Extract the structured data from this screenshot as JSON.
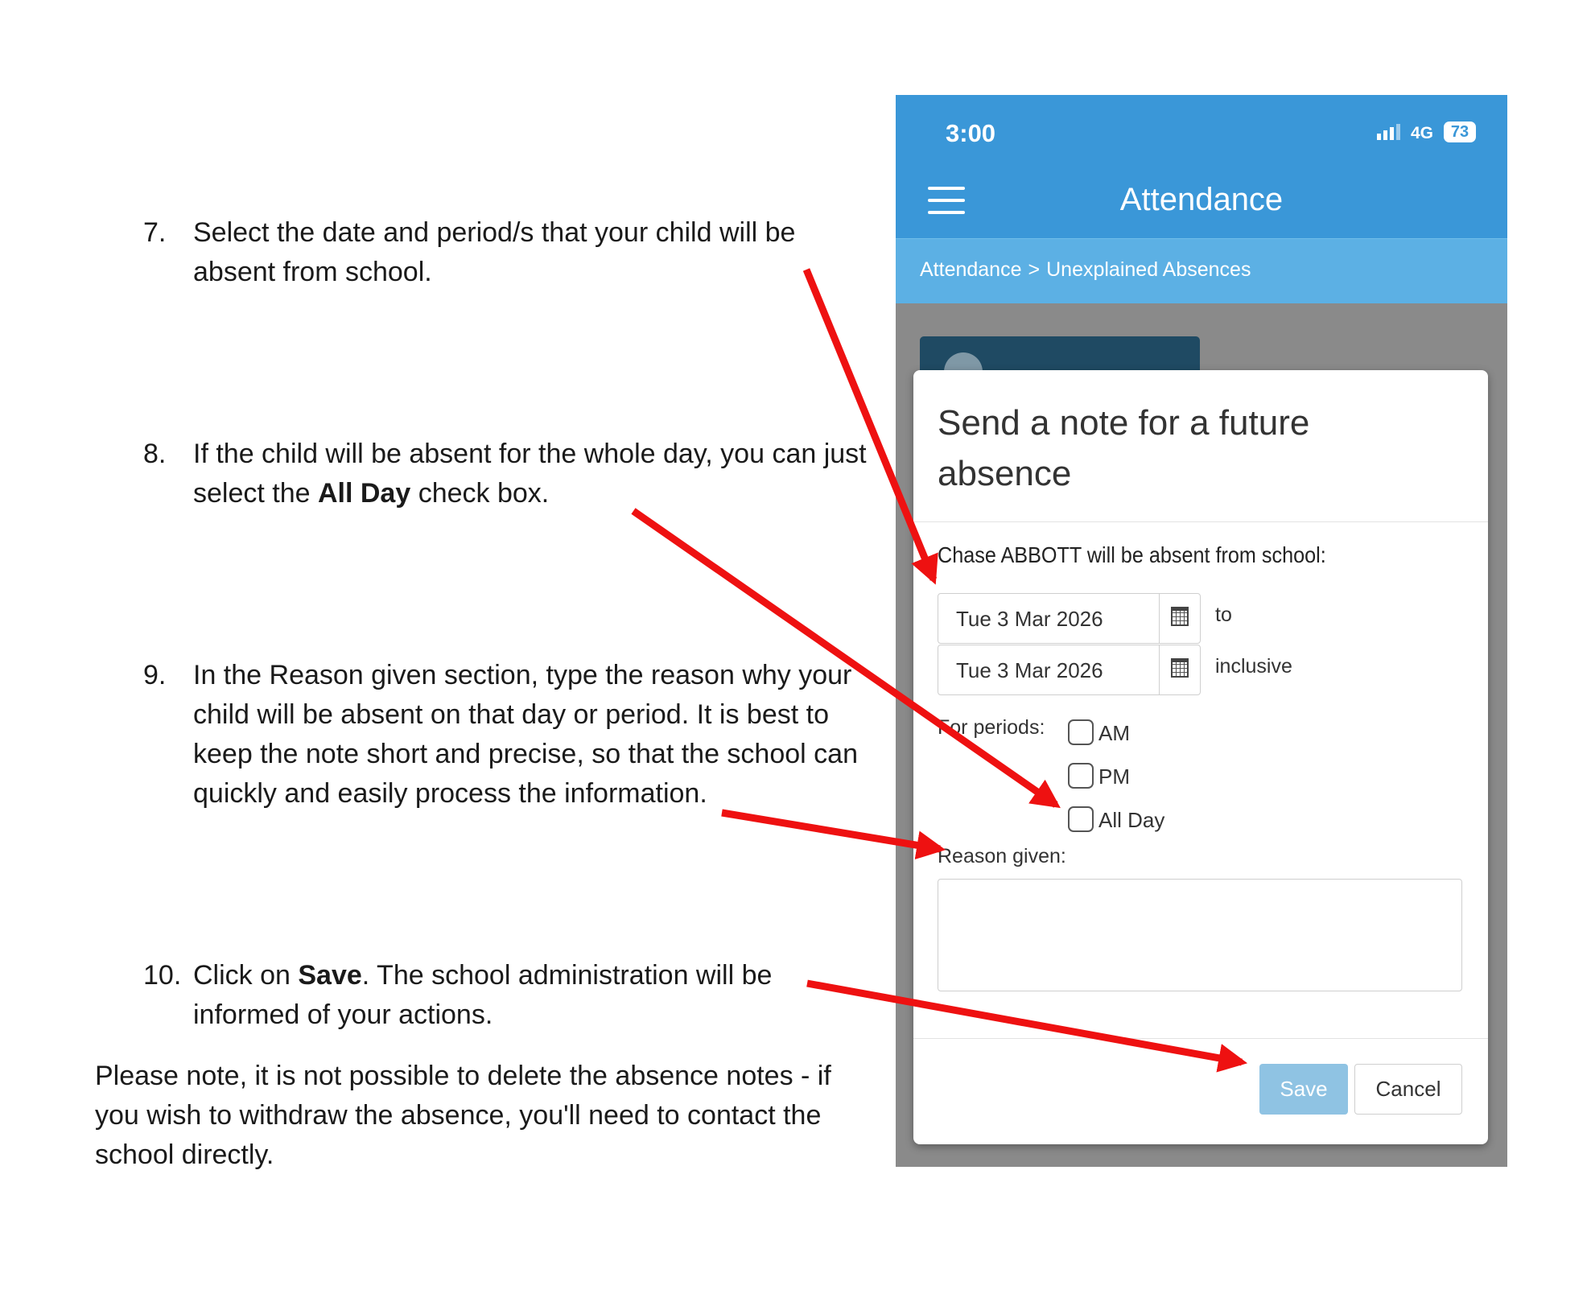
{
  "instructions": [
    {
      "number": "7.",
      "text": "Select the date and period/s that your child will be absent from school."
    },
    {
      "number": "8.",
      "text_before": "If the child will be absent for the whole day, you can just select the ",
      "bold": "All Day",
      "text_after": " check box."
    },
    {
      "number": "9.",
      "text": "In the Reason given section, type the reason why your child will be absent on that day or period. It is best to keep the note short and precise, so that the school can quickly and easily process the information."
    },
    {
      "number": "10.",
      "text_before": "Click on ",
      "bold": "Save",
      "text_after": ". The school administration will be informed of your actions."
    }
  ],
  "note": "Please note, it is not possible to delete the absence notes - if you wish to withdraw the absence, you'll need to contact the school directly.",
  "phone": {
    "status_bar": {
      "time": "3:00",
      "network": "4G",
      "battery": "73"
    },
    "app_title": "Attendance",
    "breadcrumb": [
      "Attendance",
      "Unexplained Absences"
    ],
    "breadcrumb_separator": ">",
    "modal": {
      "title": "Send a note for a future absence",
      "absent_label": "Chase ABBOTT will be absent from school:",
      "date_from": "Tue 3 Mar 2026",
      "date_to": "Tue 3 Mar 2026",
      "to_label": "to",
      "inclusive_label": "inclusive",
      "periods_label": "For periods:",
      "periods": [
        {
          "label": "AM",
          "checked": false
        },
        {
          "label": "PM",
          "checked": false
        },
        {
          "label": "All Day",
          "checked": false
        }
      ],
      "reason_label": "Reason given:",
      "reason_value": "",
      "save_label": "Save",
      "cancel_label": "Cancel"
    }
  },
  "colors": {
    "header_blue": "#3a97d8",
    "breadcrumb_blue": "#5cb0e4",
    "save_button": "#8fc3e3",
    "annotation_arrow": "#ee1111"
  },
  "icons": [
    "menu-icon",
    "calendar-icon",
    "signal-icon",
    "battery-icon",
    "chevron-right-icon"
  ]
}
